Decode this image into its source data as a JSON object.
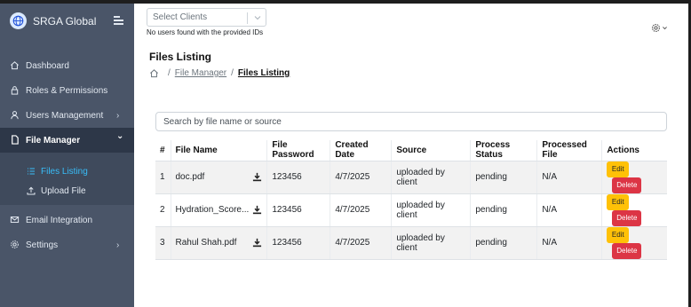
{
  "app": {
    "name": "SRGA Global"
  },
  "sidebar": {
    "items": [
      {
        "label": "Dashboard",
        "icon": "home-icon"
      },
      {
        "label": "Roles & Permissions",
        "icon": "lock-icon"
      },
      {
        "label": "Users Management",
        "icon": "user-icon",
        "chevron": "›"
      },
      {
        "label": "File Manager",
        "icon": "file-icon",
        "chevron": "⌄"
      },
      {
        "label": "Email Integration",
        "icon": "mail-icon"
      },
      {
        "label": "Settings",
        "icon": "gear-icon",
        "chevron": "›"
      }
    ],
    "submenu": [
      {
        "label": "Files Listing",
        "icon": "list-icon"
      },
      {
        "label": "Upload File",
        "icon": "upload-icon"
      }
    ]
  },
  "header": {
    "client_select_placeholder": "Select Clients",
    "no_users_message": "No users found with the provided IDs"
  },
  "page": {
    "title": "Files Listing",
    "breadcrumb": {
      "parent": "File Manager",
      "current": "Files Listing"
    }
  },
  "search": {
    "placeholder": "Search by file name or source"
  },
  "table": {
    "headers": [
      "#",
      "File Name",
      "File Password",
      "Created Date",
      "Source",
      "Process Status",
      "Processed File",
      "Actions"
    ],
    "rows": [
      {
        "num": "1",
        "file_name": "doc.pdf",
        "password": "123456",
        "created": "4/7/2025",
        "source": "uploaded by client",
        "status": "pending",
        "processed": "N/A"
      },
      {
        "num": "2",
        "file_name": "Hydration_Score...",
        "password": "123456",
        "created": "4/7/2025",
        "source": "uploaded by client",
        "status": "pending",
        "processed": "N/A"
      },
      {
        "num": "3",
        "file_name": "Rahul Shah.pdf",
        "password": "123456",
        "created": "4/7/2025",
        "source": "uploaded by client",
        "status": "pending",
        "processed": "N/A"
      }
    ],
    "actions": {
      "edit": "Edit",
      "delete": "Delete"
    }
  },
  "colors": {
    "sidebar_bg": "#4a5568",
    "active_item_bg": "#2d3748",
    "submenu_active": "#38bdf8",
    "edit_button": "#ffc107",
    "delete_button": "#dc3545"
  }
}
